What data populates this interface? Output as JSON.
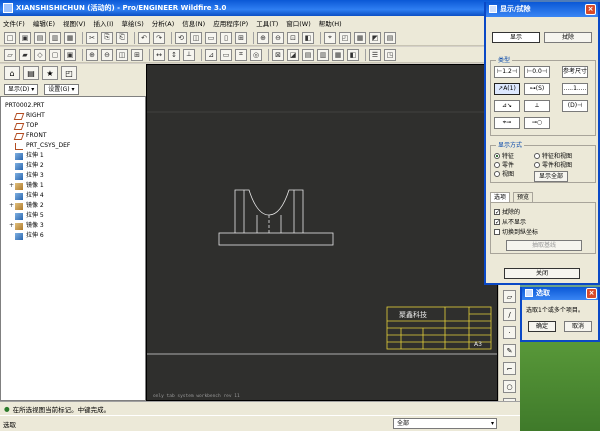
{
  "window": {
    "title": "XIANSHISHICHUN (活动的) - Pro/ENGINEER Wildfire 3.0"
  },
  "menu": [
    "文件(F)",
    "编辑(E)",
    "视图(V)",
    "插入(I)",
    "草绘(S)",
    "分析(A)",
    "信息(N)",
    "应用程序(P)",
    "工具(T)",
    "窗口(W)",
    "帮助(H)"
  ],
  "navigator": {
    "show_label": "显示(D)",
    "settings_label": "设置(G)",
    "tree_items": [
      {
        "label": "PRT0002.PRT",
        "icon": "part-icon",
        "expand": ""
      },
      {
        "label": "RIGHT",
        "icon": "plane-icon",
        "expand": ""
      },
      {
        "label": "TOP",
        "icon": "plane-icon",
        "expand": ""
      },
      {
        "label": "FRONT",
        "icon": "plane-icon",
        "expand": ""
      },
      {
        "label": "PRT_CSYS_DEF",
        "icon": "csys-icon",
        "expand": ""
      },
      {
        "label": "拉伸 1",
        "icon": "extrude-icon",
        "expand": ""
      },
      {
        "label": "拉伸 2",
        "icon": "extrude-icon",
        "expand": ""
      },
      {
        "label": "拉伸 3",
        "icon": "extrude-icon",
        "expand": ""
      },
      {
        "label": "镜像 1",
        "icon": "mirror-icon",
        "expand": "+"
      },
      {
        "label": "拉伸 4",
        "icon": "extrude-icon",
        "expand": ""
      },
      {
        "label": "镜像 2",
        "icon": "mirror-icon",
        "expand": "+"
      },
      {
        "label": "拉伸 5",
        "icon": "extrude-icon",
        "expand": ""
      },
      {
        "label": "镜像 3",
        "icon": "mirror-icon",
        "expand": "+"
      },
      {
        "label": "拉伸 6",
        "icon": "extrude-icon",
        "expand": ""
      }
    ]
  },
  "titleblock": {
    "company": "聚鑫科技",
    "cells": [
      "",
      "",
      "",
      "A3"
    ]
  },
  "graphics_footer": "only tab  system  workbench  rev 11",
  "status": {
    "message": "在所选视图当前标记。中键完成。",
    "prompt_label": "选取",
    "filter": "全部"
  },
  "dialog_display": {
    "title": "显示/拭除",
    "show_btn": "显示",
    "erase_btn": "拭除",
    "type_label": "类型",
    "tools": [
      "⊢1.2⊣",
      "⊢0.0⊣",
      "参考尺寸",
      "↗A(1)",
      "⊶(S)",
      ".....1.....",
      "⊿↘",
      "⟂",
      "(D)⊣",
      "⌖⊸",
      "⊸○"
    ],
    "show_by_label": "显示方式",
    "radios": [
      {
        "label": "特征",
        "on": true
      },
      {
        "label": "特征和视图",
        "on": false
      },
      {
        "label": "零件",
        "on": false
      },
      {
        "label": "零件和视图",
        "on": false
      },
      {
        "label": "视图",
        "on": false
      }
    ],
    "show_all_btn": "显示全部",
    "tab_options": "选项",
    "tab_preview": "预览",
    "checks": [
      {
        "label": "拭除的",
        "checked": true
      },
      {
        "label": "从不显示",
        "checked": true
      },
      {
        "label": "切换到纵坐标",
        "checked": false
      }
    ],
    "extract_btn": "抽取基线",
    "close_btn": "关闭"
  },
  "dialog_select": {
    "title": "选取",
    "prompt": "选取1个或多个项目。",
    "ok_btn": "确定",
    "cancel_btn": "取消"
  },
  "colors": {
    "titlebar": "#0a58d6",
    "graphics_bg": "#2f2f2d",
    "drawing_line": "#e8e8e8",
    "titleblock_line": "#e6d23a"
  }
}
